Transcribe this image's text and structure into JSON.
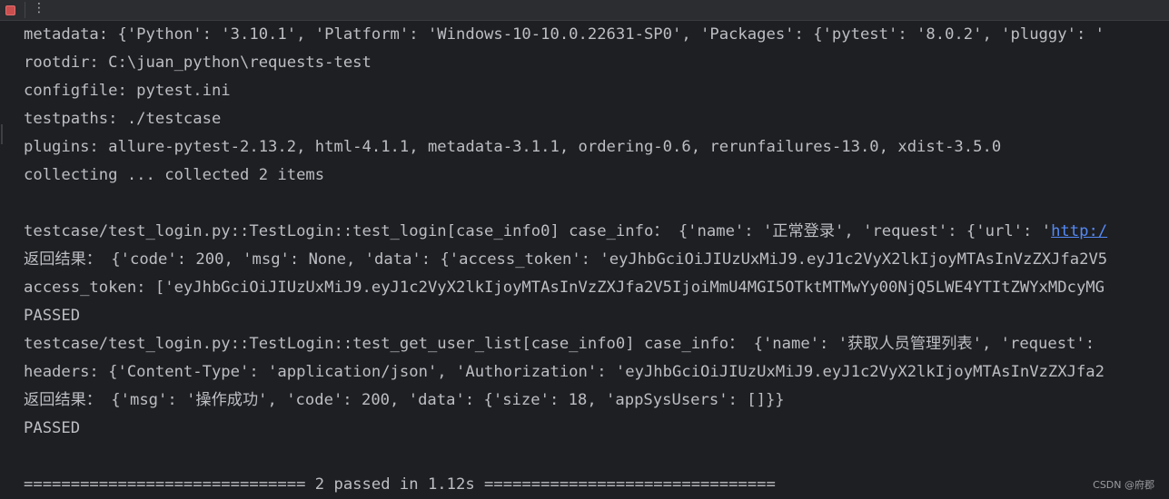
{
  "toolbar": {
    "stop_icon": "stop-icon",
    "more_icon": "more-vertical-icon",
    "more_glyph": "⋮",
    "stop_color": "#c94f4f"
  },
  "console": {
    "metadata": "metadata: {'Python': '3.10.1', 'Platform': 'Windows-10-10.0.22631-SP0', 'Packages': {'pytest': '8.0.2', 'pluggy': '",
    "rootdir": "rootdir: C:\\juan_python\\requests-test",
    "configfile": "configfile: pytest.ini",
    "testpaths": "testpaths: ./testcase",
    "plugins": "plugins: allure-pytest-2.13.2, html-4.1.1, metadata-3.1.1, ordering-0.6, rerunfailures-13.0, xdist-3.5.0",
    "collecting": "collecting ... collected 2 items",
    "test1_header": "testcase/test_login.py::TestLogin::test_login[case_info0] case_info： {'name': '正常登录', 'request': {'url': '",
    "test1_header_link": "http:/",
    "test1_result": "返回结果： {'code': 200, 'msg': None, 'data': {'access_token': 'eyJhbGciOiJIUzUxMiJ9.eyJ1c2VyX2lkIjoyMTAsInVzZXJfa2V5",
    "test1_token": "access_token: ['eyJhbGciOiJIUzUxMiJ9.eyJ1c2VyX2lkIjoyMTAsInVzZXJfa2V5IjoiMmU4MGI5OTktMTMwYy00NjQ5LWE4YTItZWYxMDcyMG",
    "test1_status": "PASSED",
    "test2_header": "testcase/test_login.py::TestLogin::test_get_user_list[case_info0] case_info： {'name': '获取人员管理列表', 'request': ",
    "test2_headers": "headers: {'Content-Type': 'application/json', 'Authorization': 'eyJhbGciOiJIUzUxMiJ9.eyJ1c2VyX2lkIjoyMTAsInVzZXJfa2",
    "test2_result": "返回结果： {'msg': '操作成功', 'code': 200, 'data': {'size': 18, 'appSysUsers': []}}",
    "test2_status": "PASSED",
    "summary": "============================== 2 passed in 1.12s ==============================="
  },
  "watermark": "CSDN @府郡",
  "colors": {
    "background": "#1e1f22",
    "text": "#bcbec4",
    "link": "#548af7"
  }
}
